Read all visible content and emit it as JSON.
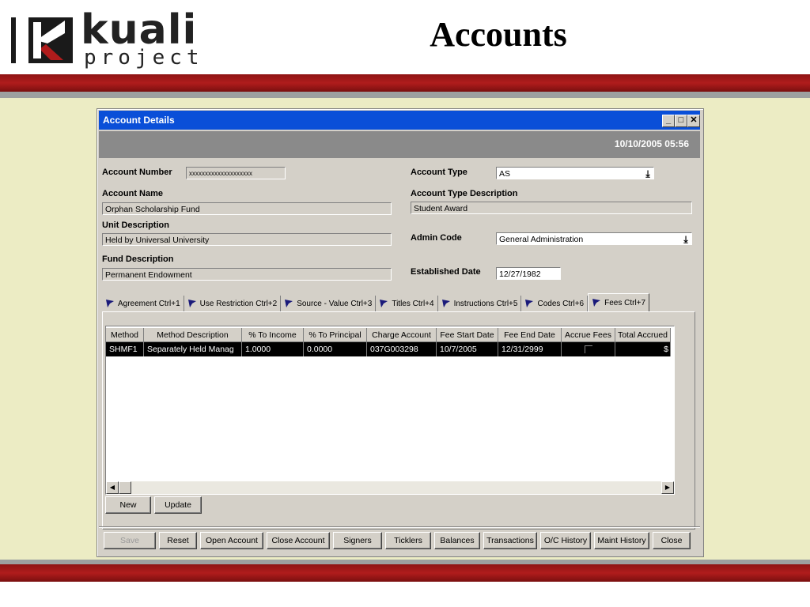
{
  "slide": {
    "logo_main": "kuali",
    "logo_sub": "project",
    "title": "Accounts"
  },
  "window": {
    "title": "Account Details",
    "datetime": "10/10/2005 05:56"
  },
  "form": {
    "account_number_label": "Account Number",
    "account_number_value": "xxxxxxxxxxxxxxxxxxxx",
    "account_type_label": "Account Type",
    "account_type_value": "AS",
    "account_name_label": "Account Name",
    "account_name_value": "Orphan Scholarship Fund",
    "account_type_desc_label": "Account Type Description",
    "account_type_desc_value": "Student Award",
    "unit_desc_label": "Unit Description",
    "unit_desc_value": "Held by Universal University",
    "admin_code_label": "Admin Code",
    "admin_code_value": "General Administration",
    "fund_desc_label": "Fund Description",
    "fund_desc_value": "Permanent Endowment",
    "established_label": "Established Date",
    "established_value": "12/27/1982"
  },
  "tabs": [
    {
      "label": "Agreement Ctrl+1"
    },
    {
      "label": "Use Restriction Ctrl+2"
    },
    {
      "label": "Source - Value Ctrl+3"
    },
    {
      "label": "Titles Ctrl+4"
    },
    {
      "label": "Instructions Ctrl+5"
    },
    {
      "label": "Codes Ctrl+6"
    },
    {
      "label": "Fees Ctrl+7"
    }
  ],
  "grid": {
    "columns": [
      "Method",
      "Method Description",
      "% To Income",
      "% To Principal",
      "Charge Account",
      "Fee Start Date",
      "Fee End Date",
      "Accrue Fees",
      "Total Accrued"
    ],
    "rows": [
      [
        "SHMF1",
        "Separately Held Manag",
        "1.0000",
        "0.0000",
        "037G003298",
        "10/7/2005",
        "12/31/2999",
        "",
        "$"
      ]
    ]
  },
  "grid_buttons": {
    "new": "New",
    "update": "Update"
  },
  "bottom_buttons": [
    "Save",
    "Reset",
    "Open Account",
    "Close Account",
    "Signers",
    "Ticklers",
    "Balances",
    "Transactions",
    "O/C History",
    "Maint History",
    "Close"
  ],
  "colors": {
    "titlebar": "#0a4fd8",
    "band_red": "#b01c1c",
    "content_bg": "#ececc4"
  }
}
